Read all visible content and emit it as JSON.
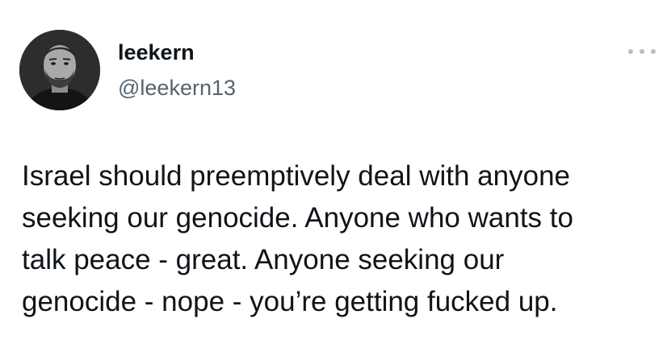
{
  "author": {
    "display_name": "leekern",
    "handle": "@leekern13",
    "avatar_icon": "profile-photo"
  },
  "menu": {
    "icon": "more-options-icon"
  },
  "tweet": {
    "lines": [
      "Israel should preemptively deal with anyone",
      "seeking our genocide. Anyone who wants to",
      "talk peace - great. Anyone seeking our",
      "genocide - nope - you’re getting fucked up."
    ]
  },
  "colors": {
    "text_primary": "#0f1419",
    "text_secondary": "#536471",
    "background": "#ffffff"
  }
}
